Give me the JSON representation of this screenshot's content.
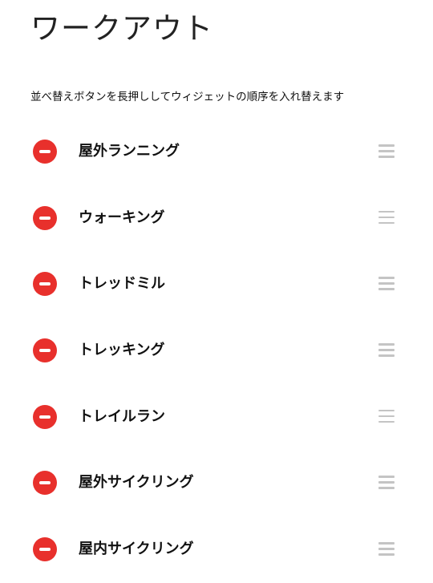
{
  "header": {
    "title": "ワークアウト"
  },
  "instructions": "並べ替えボタンを長押ししてウィジェットの順序を入れ替えます",
  "icons": {
    "remove": "remove-circle-icon",
    "drag": "drag-handle-icon"
  },
  "colors": {
    "remove_button": "#e8302c",
    "drag_handle": "#c4c4c4"
  },
  "workouts": [
    {
      "label": "屋外ランニング"
    },
    {
      "label": "ウォーキング"
    },
    {
      "label": "トレッドミル"
    },
    {
      "label": "トレッキング"
    },
    {
      "label": "トレイルラン"
    },
    {
      "label": "屋外サイクリング"
    },
    {
      "label": "屋内サイクリング"
    }
  ]
}
